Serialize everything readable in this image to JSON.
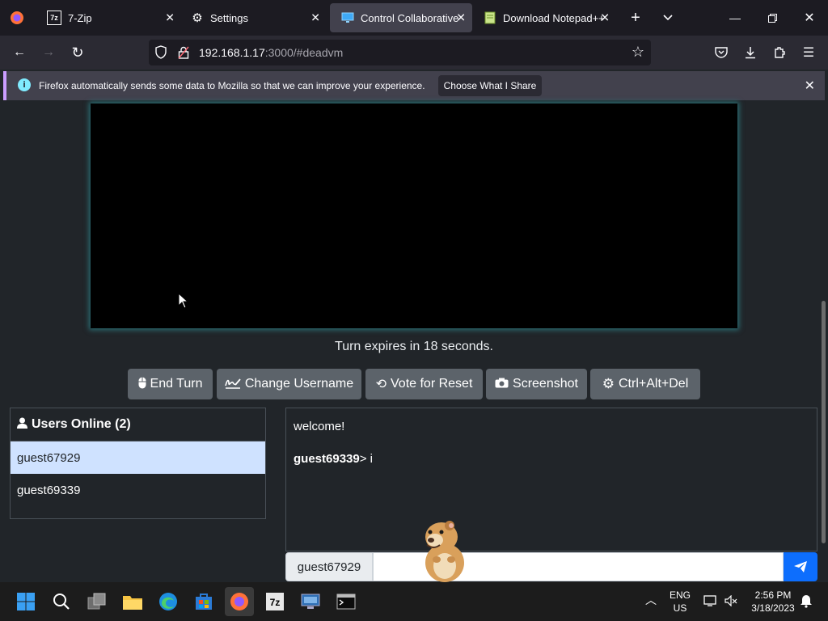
{
  "browser": {
    "tabs": [
      {
        "label": "7-Zip",
        "icon": "7zip-icon"
      },
      {
        "label": "Settings",
        "icon": "gear-icon"
      },
      {
        "label": "Control Collaborative V",
        "icon": "monitor-icon"
      },
      {
        "label": "Download Notepad++",
        "icon": "notepad-icon"
      }
    ],
    "url_host": "192.168.1.17",
    "url_rest": ":3000/#deadvm"
  },
  "notification": {
    "text": "Firefox automatically sends some data to Mozilla so that we can improve your experience.",
    "button_label": "Choose What I Share"
  },
  "vm": {
    "turn_text": "Turn expires in 18 seconds.",
    "buttons": {
      "end_turn": "End Turn",
      "change_username": "Change Username",
      "vote_reset": "Vote for Reset",
      "screenshot": "Screenshot",
      "ctrl_alt_del": "Ctrl+Alt+Del"
    }
  },
  "users": {
    "header": "Users Online (2)",
    "list": [
      "guest67929",
      "guest69339"
    ]
  },
  "chat": {
    "welcome": "welcome!",
    "messages": [
      {
        "user": "guest69339",
        "text": "> i"
      }
    ],
    "username": "guest67929"
  },
  "taskbar": {
    "lang_top": "ENG",
    "lang_bottom": "US",
    "time": "2:56 PM",
    "date": "3/18/2023"
  },
  "colors": {
    "accent": "#0d6efd",
    "button": "#5c636a",
    "selected_user": "#cfe2ff"
  }
}
